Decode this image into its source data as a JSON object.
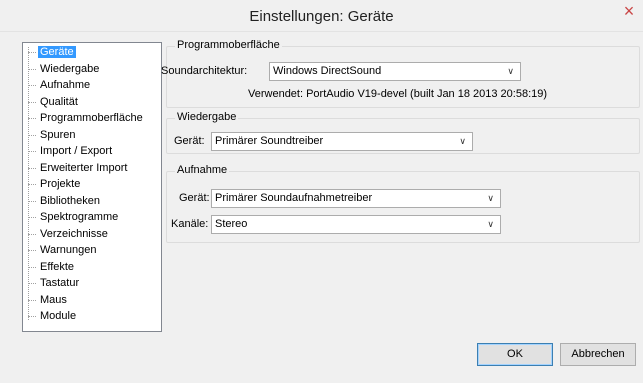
{
  "window": {
    "title": "Einstellungen: Geräte",
    "close_glyph": "×"
  },
  "tree": {
    "items": [
      {
        "label": "Geräte",
        "selected": true
      },
      {
        "label": "Wiedergabe"
      },
      {
        "label": "Aufnahme"
      },
      {
        "label": "Qualität"
      },
      {
        "label": "Programmoberfläche"
      },
      {
        "label": "Spuren"
      },
      {
        "label": "Import / Export"
      },
      {
        "label": "Erweiterter Import"
      },
      {
        "label": "Projekte"
      },
      {
        "label": "Bibliotheken"
      },
      {
        "label": "Spektrogramme"
      },
      {
        "label": "Verzeichnisse"
      },
      {
        "label": "Warnungen"
      },
      {
        "label": "Effekte"
      },
      {
        "label": "Tastatur"
      },
      {
        "label": "Maus"
      },
      {
        "label": "Module"
      }
    ]
  },
  "interface_group": {
    "title": "Programmoberfläche",
    "host_label": "Soundarchitektur:",
    "host_value": "Windows DirectSound",
    "using_label": "Verwendet: PortAudio V19-devel (built Jan 18 2013 20:58:19)"
  },
  "playback_group": {
    "title": "Wiedergabe",
    "device_label": "Gerät:",
    "device_value": "Primärer Soundtreiber"
  },
  "recording_group": {
    "title": "Aufnahme",
    "device_label": "Gerät:",
    "device_value": "Primärer Soundaufnahmetreiber",
    "channels_label": "Kanäle:",
    "channels_value": "Stereo"
  },
  "buttons": {
    "ok": "OK",
    "cancel": "Abbrechen"
  },
  "icons": {
    "dropdown": "chevron-down-icon"
  }
}
